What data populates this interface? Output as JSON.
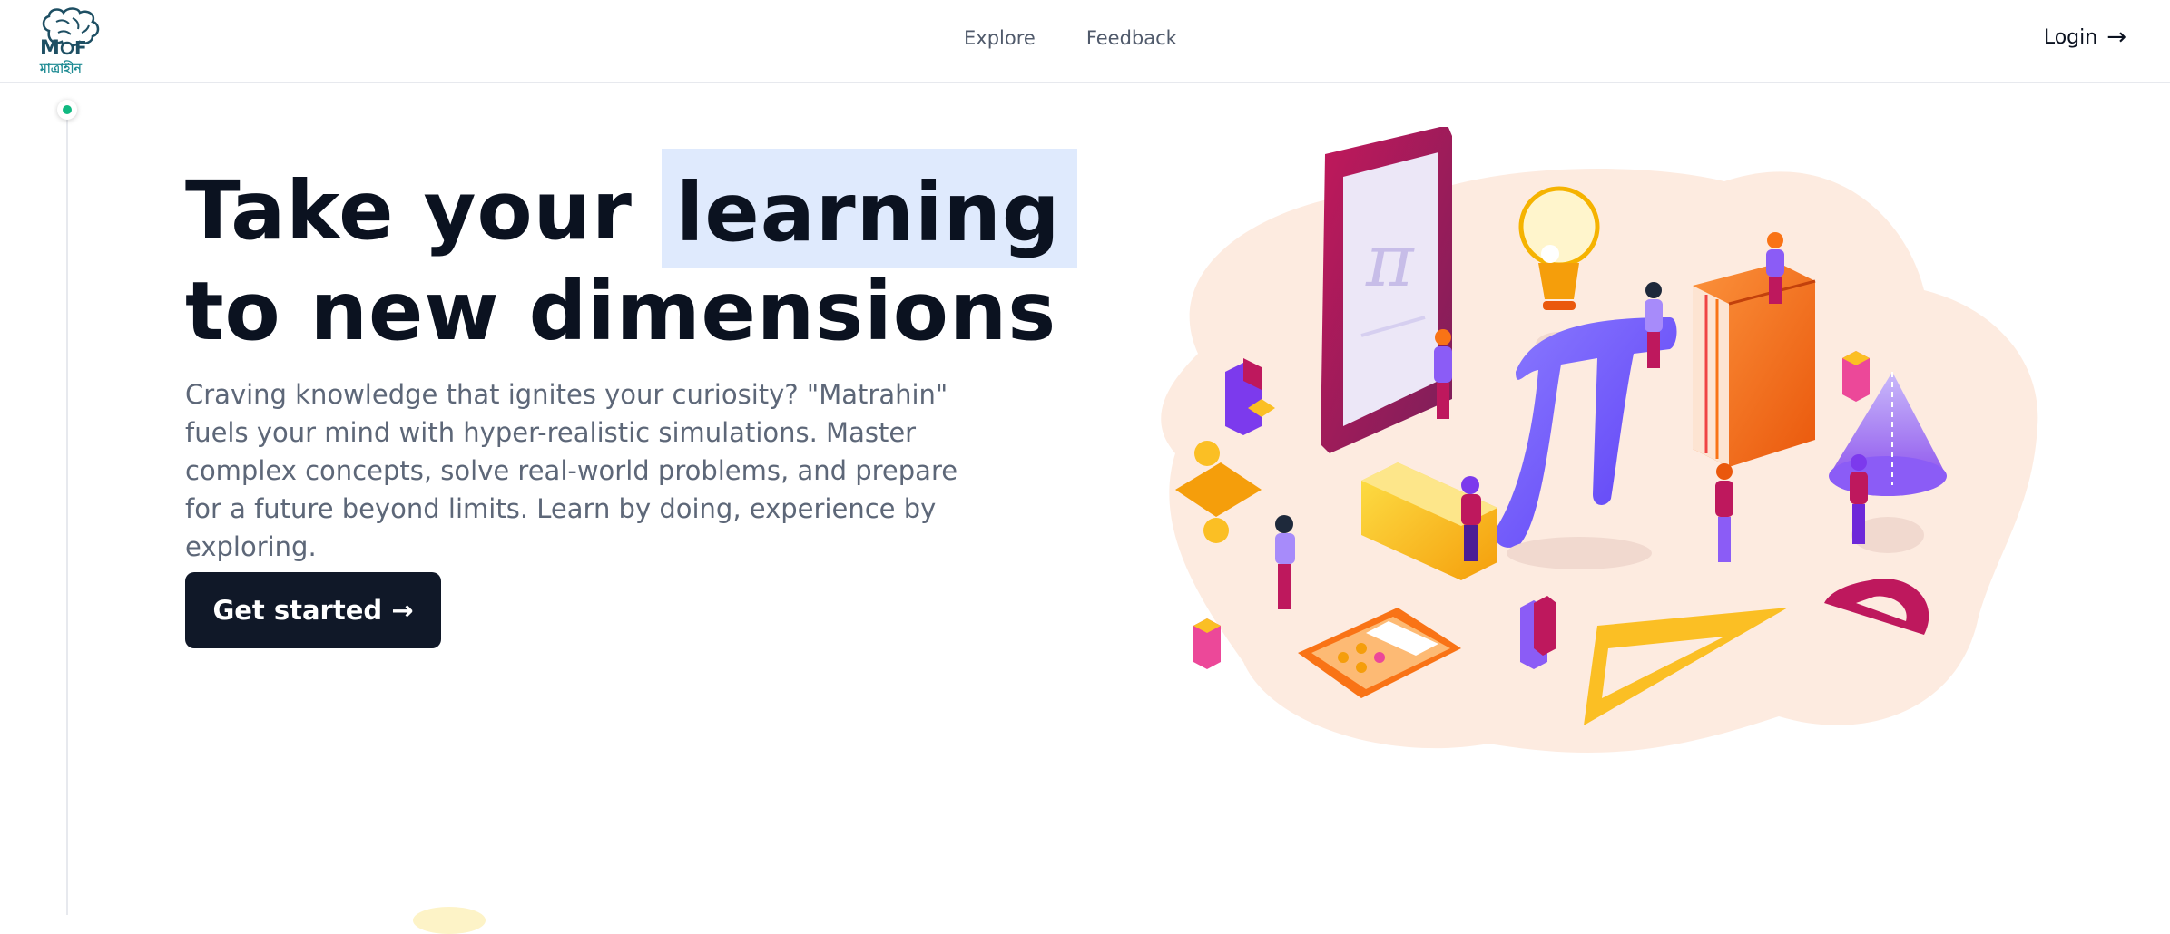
{
  "header": {
    "logo_text": "মাত্রাহীন",
    "nav": [
      "Explore",
      "Feedback"
    ],
    "login_label": "Login",
    "login_arrow": "→"
  },
  "hero": {
    "title_line1_part1": "Take your",
    "title_line1_highlight": "learning",
    "title_line2": "to new dimensions",
    "description": "Craving knowledge that ignites your curiosity? \"Matrahin\" fuels your mind with hyper-realistic simulations. Master complex concepts, solve real-world problems, and prepare for a future beyond limits. Learn by doing, experience by exploring.",
    "cta_label": "Get started →"
  },
  "colors": {
    "accent": "#101828",
    "highlight": "#dfeafd",
    "timeline_dot": "#10b981",
    "blob": "#fdebe0"
  }
}
